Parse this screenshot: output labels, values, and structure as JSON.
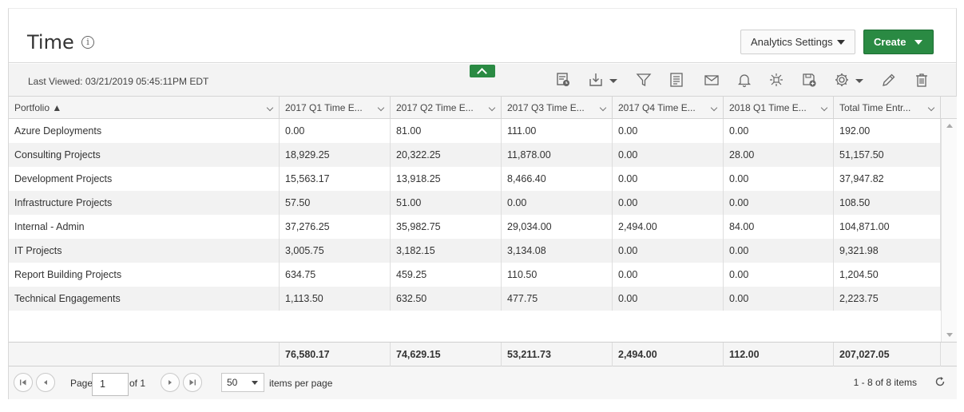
{
  "page": {
    "title": "Time",
    "info_icon": "info-icon"
  },
  "header": {
    "analytics_settings_label": "Analytics Settings",
    "create_label": "Create",
    "colors": {
      "create_bg": "#2a8a43",
      "create_border": "#1d6e33"
    }
  },
  "toolbar": {
    "last_viewed_label": "Last Viewed:",
    "last_viewed_value": "03/21/2019 05:45:11PM EDT",
    "icons": [
      "schedule-report-icon",
      "export-icon",
      "filter-icon",
      "page-setup-icon",
      "email-icon",
      "notification-bell-icon",
      "pivot-icon",
      "save-as-icon",
      "settings-gear-icon",
      "edit-pencil-icon",
      "delete-trash-icon"
    ]
  },
  "grid": {
    "columns": [
      {
        "label": "Portfolio ▲"
      },
      {
        "label": "2017 Q1 Time E..."
      },
      {
        "label": "2017 Q2 Time E..."
      },
      {
        "label": "2017 Q3 Time E..."
      },
      {
        "label": "2017 Q4 Time E..."
      },
      {
        "label": "2018 Q1 Time E..."
      },
      {
        "label": "Total Time Entr..."
      }
    ],
    "rows": [
      [
        "Azure Deployments",
        "0.00",
        "81.00",
        "111.00",
        "0.00",
        "0.00",
        "192.00"
      ],
      [
        "Consulting Projects",
        "18,929.25",
        "20,322.25",
        "11,878.00",
        "0.00",
        "28.00",
        "51,157.50"
      ],
      [
        "Development Projects",
        "15,563.17",
        "13,918.25",
        "8,466.40",
        "0.00",
        "0.00",
        "37,947.82"
      ],
      [
        "Infrastructure Projects",
        "57.50",
        "51.00",
        "0.00",
        "0.00",
        "0.00",
        "108.50"
      ],
      [
        "Internal - Admin",
        "37,276.25",
        "35,982.75",
        "29,034.00",
        "2,494.00",
        "84.00",
        "104,871.00"
      ],
      [
        "IT Projects",
        "3,005.75",
        "3,182.15",
        "3,134.08",
        "0.00",
        "0.00",
        "9,321.98"
      ],
      [
        "Report Building Projects",
        "634.75",
        "459.25",
        "110.50",
        "0.00",
        "0.00",
        "1,204.50"
      ],
      [
        "Technical Engagements",
        "1,113.50",
        "632.50",
        "477.75",
        "0.00",
        "0.00",
        "2,223.75"
      ]
    ],
    "totals": [
      "",
      "76,580.17",
      "74,629.15",
      "53,211.73",
      "2,494.00",
      "112.00",
      "207,027.05"
    ]
  },
  "pager": {
    "page_label": "Page",
    "page_value": "1",
    "of_label": "of 1",
    "page_size": "50",
    "items_per_page_label": "items per page",
    "summary": "1 - 8 of 8 items"
  }
}
